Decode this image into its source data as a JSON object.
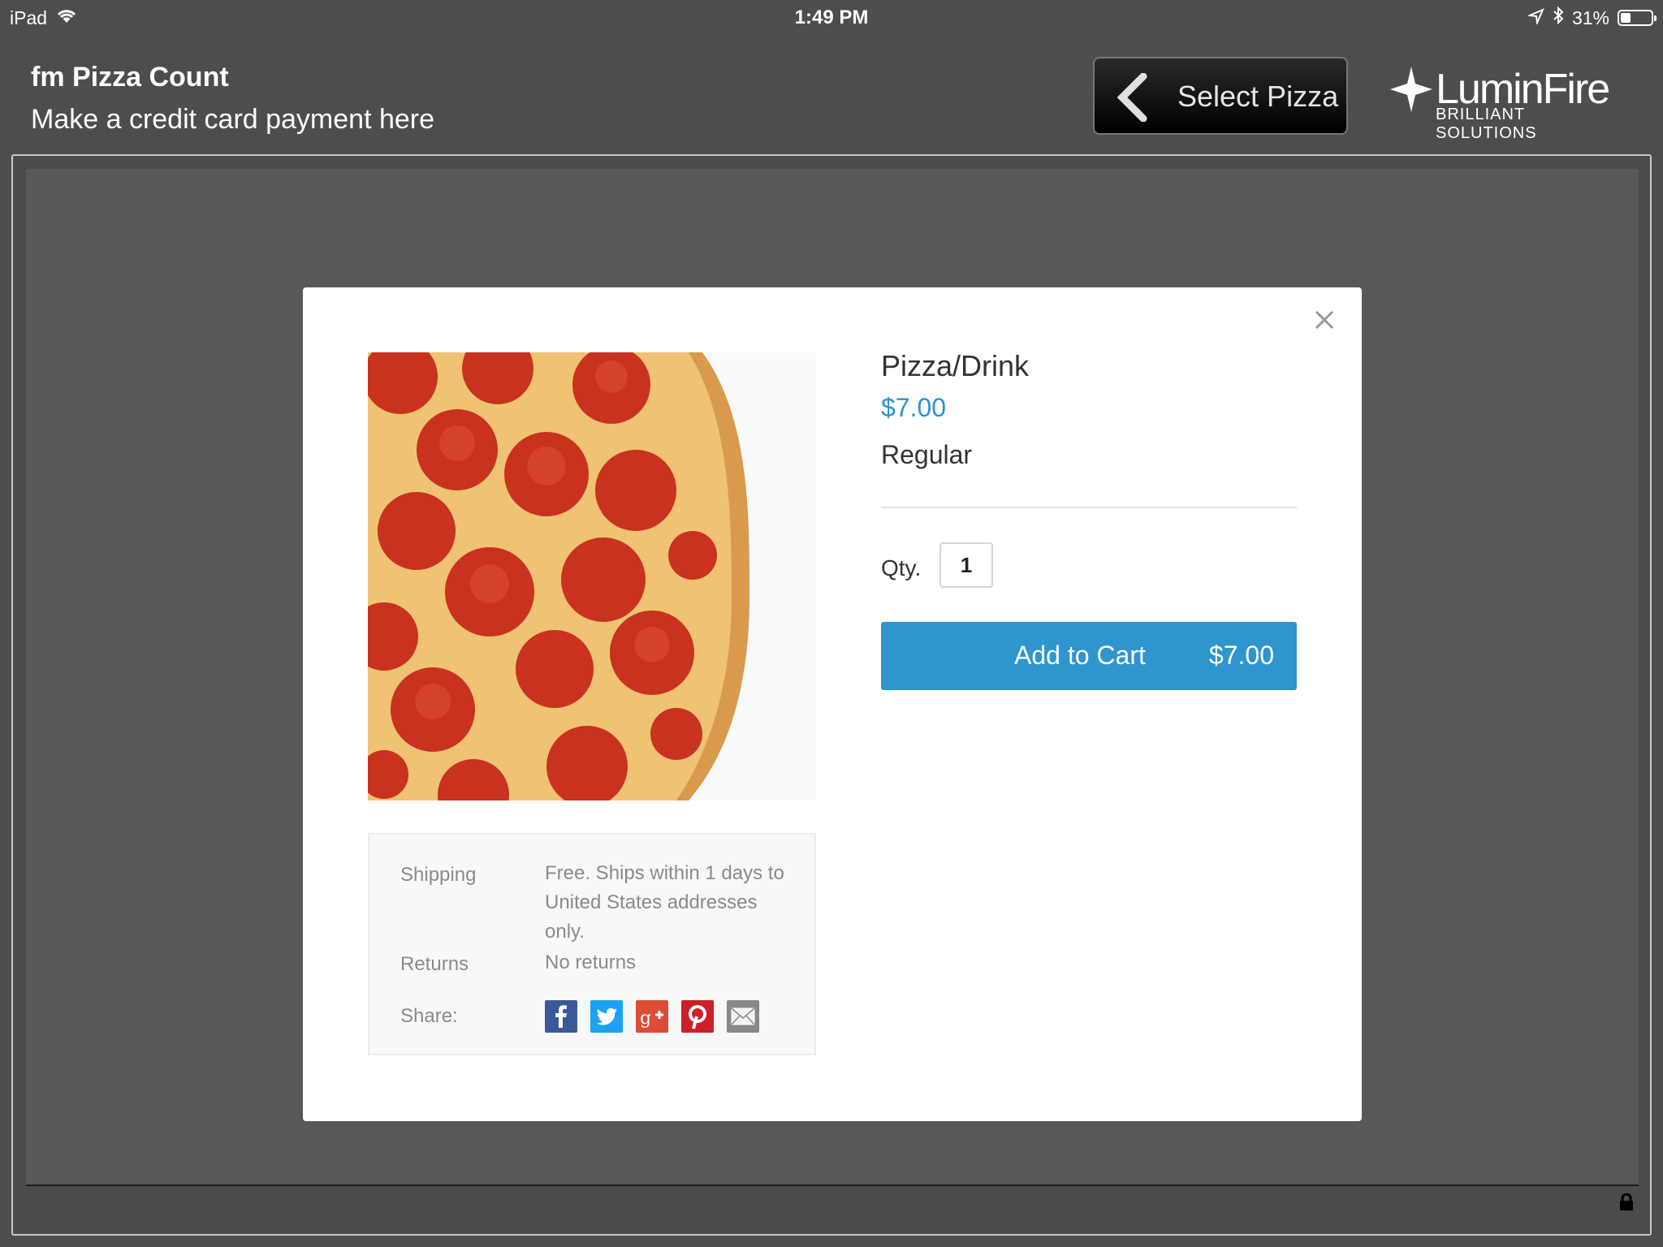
{
  "status_bar": {
    "device": "iPad",
    "time": "1:49 PM",
    "battery": "31%",
    "icons": [
      "wifi-icon",
      "location-arrow-icon",
      "bluetooth-icon",
      "battery-icon"
    ]
  },
  "header": {
    "title": "fm Pizza Count",
    "subtitle": "Make a credit card payment here",
    "back_button_label": "Select Pizza",
    "logo_name": "LuminFire",
    "logo_tagline": "BRILLIANT SOLUTIONS"
  },
  "modal": {
    "product_name": "Pizza/Drink",
    "price": "$7.00",
    "variant": "Regular",
    "qty_label": "Qty.",
    "qty_value": "1",
    "add_to_cart_label": "Add to Cart",
    "add_to_cart_price": "$7.00",
    "image_icon": "pepperoni-pizza-image",
    "info": {
      "shipping_label": "Shipping",
      "shipping_value": "Free. Ships within 1 days to United States addresses only.",
      "returns_label": "Returns",
      "returns_value": "No returns",
      "share_label": "Share:",
      "share_icons": [
        "facebook-icon",
        "twitter-icon",
        "google-plus-icon",
        "pinterest-icon",
        "email-icon"
      ]
    }
  },
  "colors": {
    "accent": "#2f95ce",
    "background": "#4d4d4f",
    "overlay": "#585858"
  }
}
